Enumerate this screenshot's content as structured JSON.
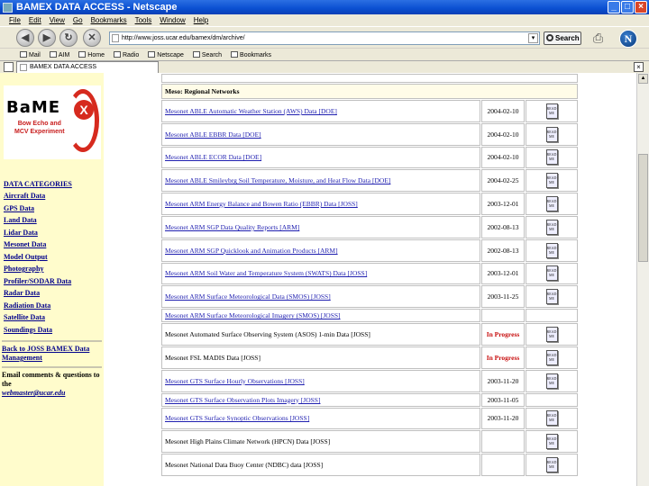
{
  "window": {
    "title": "BAMEX DATA ACCESS - Netscape"
  },
  "menu": [
    "File",
    "Edit",
    "View",
    "Go",
    "Bookmarks",
    "Tools",
    "Window",
    "Help"
  ],
  "nav": {
    "url": "http://www.joss.ucar.edu/bamex/dm/archive/",
    "search_label": "Search"
  },
  "personal_toolbar": [
    "Mail",
    "AIM",
    "Home",
    "Radio",
    "Netscape",
    "Search",
    "Bookmarks"
  ],
  "tab": {
    "label": "BAMEX DATA ACCESS"
  },
  "sidebar": {
    "logo_word": "BaME",
    "logo_mark": "X",
    "logo_tag_line1": "Bow Echo and",
    "logo_tag_line2": "MCV Experiment",
    "categories_heading": "DATA CATEGORIES",
    "categories": [
      "Aircraft Data",
      "GPS Data",
      "Land Data",
      "Lidar Data",
      "Mesonet Data",
      "Model Output",
      "Photography",
      "Profiler/SODAR Data",
      "Radar Data",
      "Radiation Data",
      "Satellite Data",
      "Soundings Data"
    ],
    "back_link": "Back to JOSS BAMEX Data Management",
    "email_text": "Email comments & questions to the",
    "email_link": "webmaster@ucar.edu"
  },
  "table": {
    "section_header": "Meso: Regional Networks",
    "readme_icon_text": "READ ME",
    "rows": [
      {
        "title": "Mesonet ABLE Automatic Weather Station (AWS) Data [DOE]",
        "link": true,
        "date": "2004-02-10",
        "status": "",
        "readme": true
      },
      {
        "title": "Mesonet ABLE EBBR Data [DOE]",
        "link": true,
        "date": "2004-02-10",
        "status": "",
        "readme": true
      },
      {
        "title": "Mesonet ABLE ECOR Data [DOE]",
        "link": true,
        "date": "2004-02-10",
        "status": "",
        "readme": true
      },
      {
        "title": "Mesonet ABLE Smileybrg Soil Temperature, Moisture, and Heat Flow Data [DOE]",
        "link": true,
        "date": "2004-02-25",
        "status": "",
        "readme": true
      },
      {
        "title": "Mesonet ARM Energy Balance and Bowen Ratio (EBBR) Data [JOSS]",
        "link": true,
        "date": "2003-12-01",
        "status": "",
        "readme": true
      },
      {
        "title": "Mesonet ARM SGP Data Quality Reports [ARM]",
        "link": true,
        "date": "2002-08-13",
        "status": "",
        "readme": true
      },
      {
        "title": "Mesonet ARM SGP Quicklook and Animation Products [ARM]",
        "link": true,
        "date": "2002-08-13",
        "status": "",
        "readme": true
      },
      {
        "title": "Mesonet ARM Soil Water and Temperature System (SWATS) Data [JOSS]",
        "link": true,
        "date": "2003-12-01",
        "status": "",
        "readme": true
      },
      {
        "title": "Mesonet ARM Surface Meteorological Data (SMOS) [JOSS]",
        "link": true,
        "date": "2003-11-25",
        "status": "",
        "readme": true
      },
      {
        "title": "Mesonet ARM Surface Meteorological Imagery (SMOS) [JOSS]",
        "link": true,
        "date": "",
        "status": "",
        "readme": false
      },
      {
        "title": "Mesonet Automated Surface Observing System (ASOS) 1-min Data [JOSS]",
        "link": false,
        "date": "",
        "status": "In Progress",
        "readme": true
      },
      {
        "title": "Mesonet FSL MADIS Data [JOSS]",
        "link": false,
        "date": "",
        "status": "In Progress",
        "readme": true
      },
      {
        "title": "Mesonet GTS Surface Hourly Observations [JOSS]",
        "link": true,
        "date": "2003-11-20",
        "status": "",
        "readme": true
      },
      {
        "title": "Mesonet GTS Surface Observation Plots Imagery [JOSS]",
        "link": true,
        "date": "2003-11-05",
        "status": "",
        "readme": false
      },
      {
        "title": "Mesonet GTS Surface Synoptic Observations [JOSS]",
        "link": true,
        "date": "2003-11-20",
        "status": "",
        "readme": true
      },
      {
        "title": "Mesonet High Plains Climate Network (HPCN) Data [JOSS]",
        "link": false,
        "date": "",
        "status": "",
        "readme": true
      },
      {
        "title": "Mesonet National Data Buoy Center (NDBC) data [JOSS]",
        "link": false,
        "date": "",
        "status": "",
        "readme": true
      }
    ]
  }
}
